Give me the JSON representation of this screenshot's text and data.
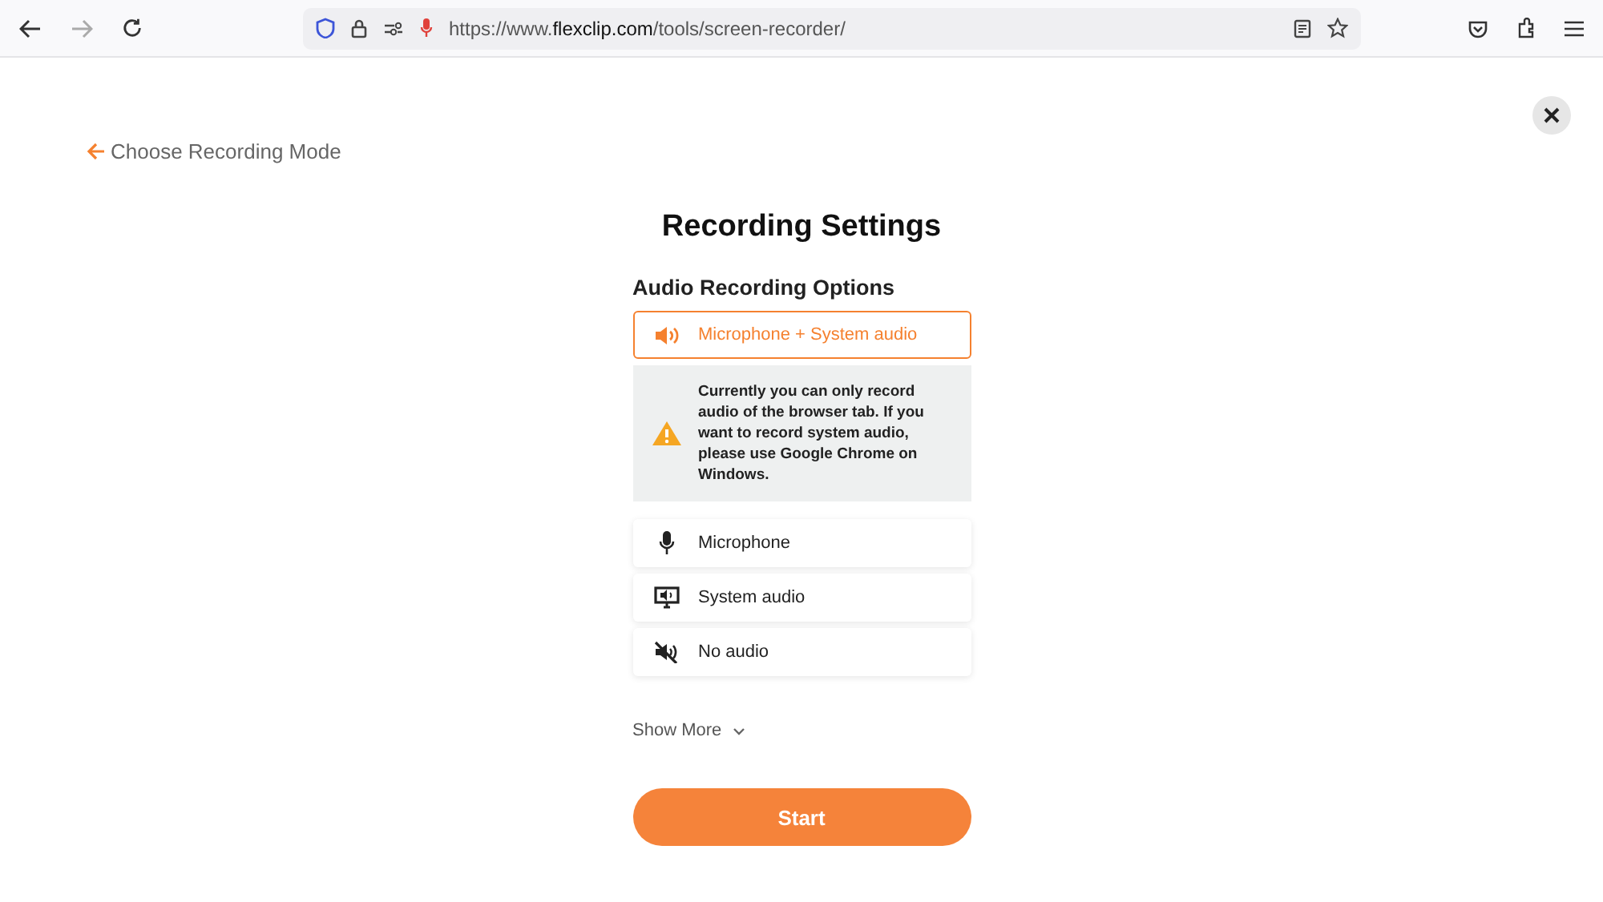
{
  "browser": {
    "url": "https://www.**flexclip.com**/tools/screen-recorder/"
  },
  "back_link": {
    "label": "Choose Recording Mode"
  },
  "title": "Recording Settings",
  "section_title": "Audio Recording Options",
  "options": [
    {
      "kind": "mic-system",
      "label": "Microphone + System audio",
      "selected": true
    },
    {
      "kind": "mic",
      "label": "Microphone",
      "selected": false
    },
    {
      "kind": "system",
      "label": "System audio",
      "selected": false
    },
    {
      "kind": "none",
      "label": "No audio",
      "selected": false
    }
  ],
  "notice": "Currently you can only record audio of the browser tab. If you want to record system audio, please use Google Chrome on Windows.",
  "show_more": "Show More",
  "start_button": "Start"
}
